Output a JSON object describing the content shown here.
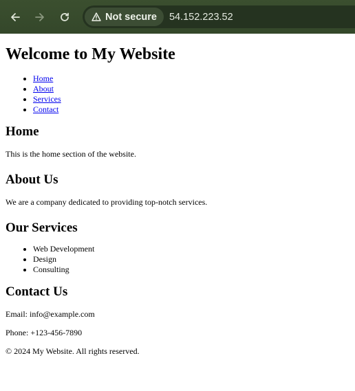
{
  "browser": {
    "security_label": "Not secure",
    "url": "54.152.223.52",
    "icons": {
      "back": "arrow-left-icon",
      "forward": "arrow-right-icon",
      "reload": "reload-icon",
      "warning": "warning-triangle-icon"
    }
  },
  "page": {
    "title": "Welcome to My Website",
    "nav": [
      {
        "label": "Home"
      },
      {
        "label": "About"
      },
      {
        "label": "Services"
      },
      {
        "label": "Contact"
      }
    ],
    "home": {
      "heading": "Home",
      "text": "This is the home section of the website."
    },
    "about": {
      "heading": "About Us",
      "text": "We are a company dedicated to providing top-notch services."
    },
    "services": {
      "heading": "Our Services",
      "items": [
        "Web Development",
        "Design",
        "Consulting"
      ]
    },
    "contact": {
      "heading": "Contact Us",
      "email": "Email: info@example.com",
      "phone": "Phone: +123-456-7890"
    },
    "footer": "© 2024 My Website. All rights reserved."
  }
}
